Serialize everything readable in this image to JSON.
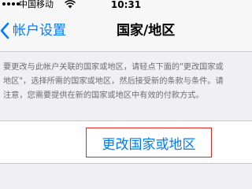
{
  "status_bar": {
    "carrier": "中国移动",
    "time": "10:31",
    "signal_bars": 4,
    "signal_total": 5
  },
  "nav": {
    "back_label": "帐户设置",
    "title": "国家/地区"
  },
  "description": {
    "lines": [
      "要更改与此帐户关联的国家或地区，请轻点下面的\"更改国家或",
      "地区\"，选择所需的国家或地区，然后接受新的条款与条件。请",
      "注意，您需要提供在新的国家或地区中有效的付款方式。"
    ]
  },
  "action": {
    "label": "更改国家或地区"
  },
  "colors": {
    "accent": "#007aff",
    "highlight_border": "#e0241c",
    "background": "#efeff4",
    "secondary_text": "#6d6d72"
  },
  "icons": {
    "back": "chevron-left-icon",
    "wifi": "wifi-icon",
    "signal": "signal-dots-icon"
  }
}
